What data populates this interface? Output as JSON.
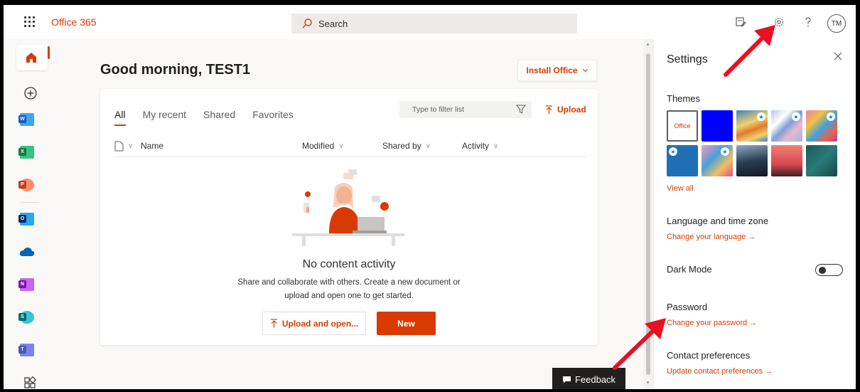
{
  "header": {
    "brand": "Office 365",
    "search_placeholder": "Search",
    "avatar_initials": "TM",
    "icons": [
      "waffle-icon",
      "search-icon",
      "whats-new-icon",
      "settings-gear-icon",
      "help-icon"
    ]
  },
  "rail": {
    "items": [
      "home",
      "create",
      "word",
      "excel",
      "powerpoint",
      "outlook",
      "onedrive",
      "onenote",
      "sharepoint",
      "teams",
      "all-apps"
    ]
  },
  "main": {
    "greeting": "Good morning, TEST1",
    "install_label": "Install Office",
    "tabs": [
      {
        "label": "All",
        "active": true
      },
      {
        "label": "My recent",
        "active": false
      },
      {
        "label": "Shared",
        "active": false
      },
      {
        "label": "Favorites",
        "active": false
      }
    ],
    "filter_placeholder": "Type to filter list",
    "upload_label": "Upload",
    "columns": [
      "Name",
      "Modified",
      "Shared by",
      "Activity"
    ],
    "empty_title": "No content activity",
    "empty_line1": "Share and collaborate with others. Create a new document or",
    "empty_line2": "upload and open one to get started.",
    "upload_open_label": "Upload and open...",
    "new_label": "New"
  },
  "settings": {
    "title": "Settings",
    "themes_heading": "Themes",
    "office_theme_label": "Office",
    "view_all": "View all",
    "language_heading": "Language and time zone",
    "language_link": "Change your language →",
    "dark_mode_label": "Dark Mode",
    "dark_mode_on": false,
    "password_heading": "Password",
    "password_link": "Change your password →",
    "contact_heading": "Contact preferences",
    "contact_link": "Update contact preferences →"
  },
  "feedback_label": "Feedback",
  "colors": {
    "accent": "#d83b01",
    "annotation_arrow": "#e81123"
  }
}
